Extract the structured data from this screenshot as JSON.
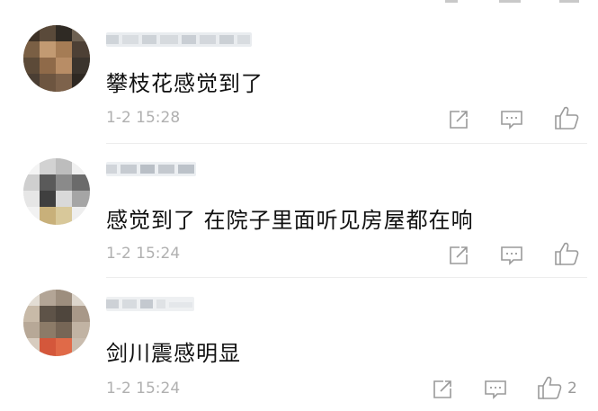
{
  "colors": {
    "text_primary": "#111111",
    "text_meta": "#b0b0b0",
    "icon_stroke": "#9a9a9a",
    "divider": "#ededed"
  },
  "comments": [
    {
      "text": "攀枝花感觉到了",
      "time": "1-2 15:28",
      "like_count": "",
      "icons": [
        "share-icon",
        "reply-icon",
        "like-icon"
      ]
    },
    {
      "text": "感觉到了 在院子里面听见房屋都在响",
      "time": "1-2 15:24",
      "like_count": "",
      "icons": [
        "share-icon",
        "reply-icon",
        "like-icon"
      ]
    },
    {
      "text": "剑川震感明显",
      "time": "1-2 15:24",
      "like_count": "2",
      "icons": [
        "share-icon",
        "reply-icon",
        "like-icon"
      ]
    }
  ]
}
